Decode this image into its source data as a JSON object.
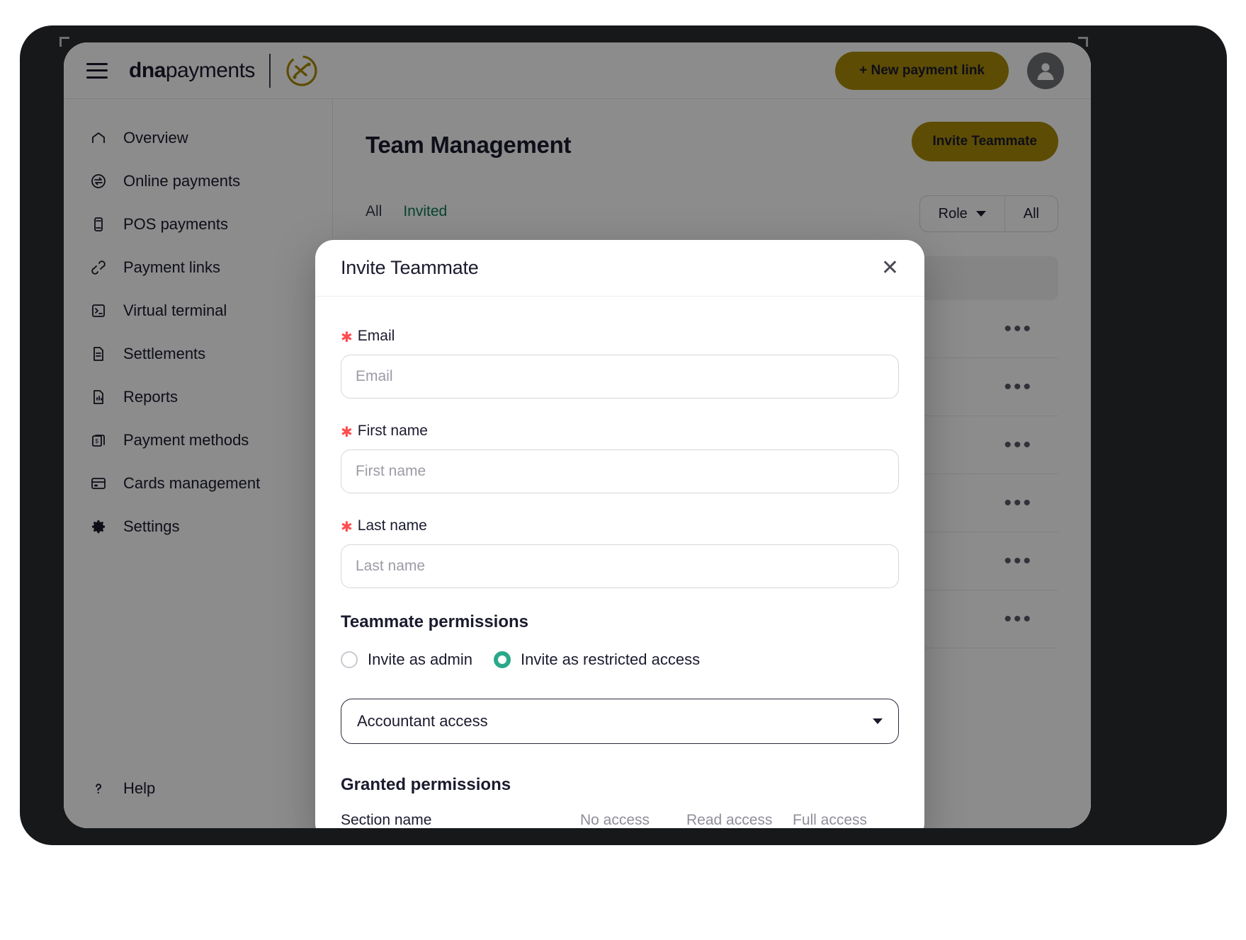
{
  "topbar": {
    "menu_icon": "hamburger-menu-icon",
    "logo_bold": "dna",
    "logo_light": "payments",
    "logo_mark": "dna-payments-logo-mark",
    "new_payment_link_label": "+ New payment link",
    "avatar_icon": "user-avatar-icon"
  },
  "sidebar": {
    "items": [
      {
        "label": "Overview",
        "icon": "home-icon"
      },
      {
        "label": "Online payments",
        "icon": "online-payments-icon"
      },
      {
        "label": "POS payments",
        "icon": "pos-terminal-icon"
      },
      {
        "label": "Payment links",
        "icon": "link-icon"
      },
      {
        "label": "Virtual terminal",
        "icon": "terminal-icon"
      },
      {
        "label": "Settlements",
        "icon": "document-icon"
      },
      {
        "label": "Reports",
        "icon": "bar-chart-document-icon"
      },
      {
        "label": "Payment methods",
        "icon": "payment-methods-icon"
      },
      {
        "label": "Cards management",
        "icon": "credit-card-icon"
      },
      {
        "label": "Settings",
        "icon": "gear-icon"
      }
    ],
    "help": {
      "label": "Help",
      "icon": "question-mark-icon"
    }
  },
  "main": {
    "page_title": "Team Management",
    "invite_button_label": "Invite Teammate",
    "tabs": [
      {
        "label": "All",
        "active": false
      },
      {
        "label": "Invited",
        "active": true
      }
    ],
    "filters": [
      {
        "label": "Role",
        "icon": "chevron-down-icon"
      },
      {
        "label": "All",
        "icon": ""
      }
    ],
    "row_menu_icon": "more-options-icon",
    "row_menu_glyph": "•••",
    "row_count": 6
  },
  "modal": {
    "title": "Invite Teammate",
    "close_icon": "close-icon",
    "close_glyph": "✕",
    "fields": [
      {
        "label": "Email",
        "required": true,
        "placeholder": "Email",
        "value": ""
      },
      {
        "label": "First name",
        "required": true,
        "placeholder": "First name",
        "value": ""
      },
      {
        "label": "Last name",
        "required": true,
        "placeholder": "Last name",
        "value": ""
      }
    ],
    "required_mark": "✱",
    "permissions_heading": "Teammate permissions",
    "radio_options": [
      {
        "label": "Invite as admin",
        "selected": false
      },
      {
        "label": "Invite as restricted access",
        "selected": true
      }
    ],
    "role_select": {
      "value": "Accountant access",
      "icon": "dropdown-caret-icon"
    },
    "granted_heading": "Granted permissions",
    "granted_columns": [
      "Section name",
      "No access",
      "Read access",
      "Full access"
    ]
  },
  "colors": {
    "brand_gold": "#a98b06",
    "accent_teal": "#2aa88a",
    "tab_active_green": "#0f7a54",
    "required_red": "#ff4d4f",
    "text_dark": "#1b1b2f"
  }
}
